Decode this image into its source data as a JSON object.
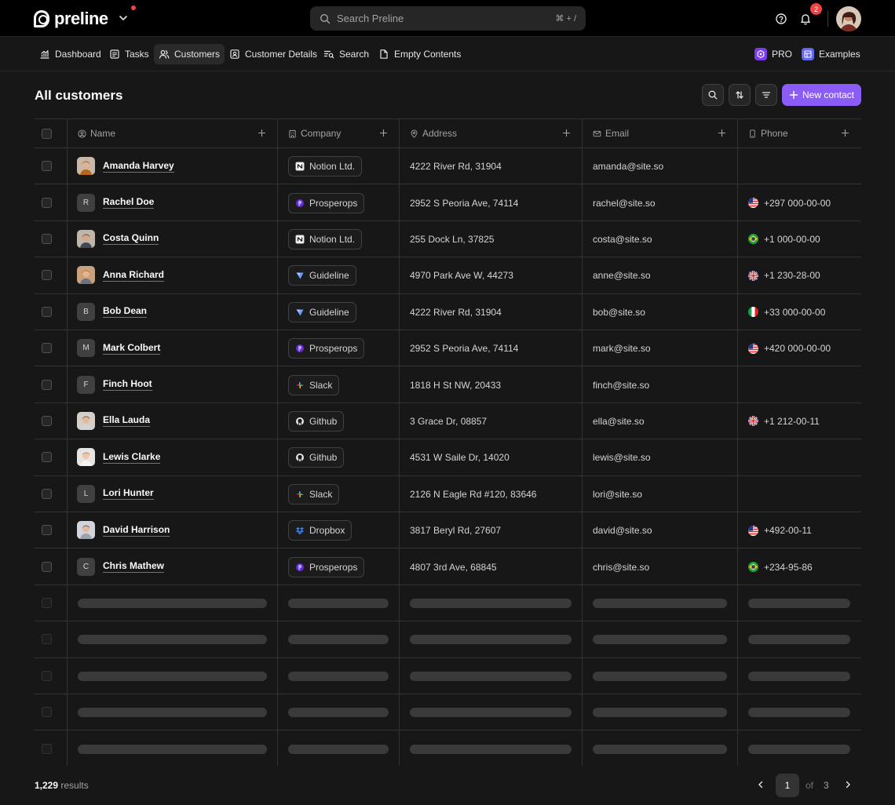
{
  "brand": {
    "name": "preline"
  },
  "search": {
    "placeholder": "Search Preline",
    "shortcut": "⌘ + /"
  },
  "notifications": {
    "count": "2"
  },
  "nav": {
    "items": [
      {
        "label": "Dashboard",
        "icon": "chart-icon"
      },
      {
        "label": "Tasks",
        "icon": "tasks-icon"
      },
      {
        "label": "Customers",
        "icon": "users-icon",
        "active": true
      },
      {
        "label": "Customer Details",
        "icon": "contact-card-icon"
      },
      {
        "label": "Search",
        "icon": "search-list-icon"
      },
      {
        "label": "Empty Contents",
        "icon": "file-icon"
      }
    ],
    "pro": "PRO",
    "examples": "Examples"
  },
  "page": {
    "title": "All customers",
    "new_contact": "New contact"
  },
  "table": {
    "columns": [
      {
        "label": "Name",
        "icon": "user-circle-icon"
      },
      {
        "label": "Company",
        "icon": "building-icon"
      },
      {
        "label": "Address",
        "icon": "pin-icon"
      },
      {
        "label": "Email",
        "icon": "mail-icon"
      },
      {
        "label": "Phone",
        "icon": "phone-icon"
      }
    ],
    "rows": [
      {
        "name": "Amanda Harvey",
        "avatar": "photo",
        "initial": "",
        "company": "Notion Ltd.",
        "company_icon": "notion",
        "address": "4222 River Rd, 31904",
        "email": "amanda@site.so",
        "phone": "",
        "flag": ""
      },
      {
        "name": "Rachel Doe",
        "avatar": "initial",
        "initial": "R",
        "company": "Prosperops",
        "company_icon": "prosperops",
        "address": "2952 S Peoria Ave, 74114",
        "email": "rachel@site.so",
        "phone": "+297 000-00-00",
        "flag": "us"
      },
      {
        "name": "Costa Quinn",
        "avatar": "photo",
        "initial": "",
        "company": "Notion Ltd.",
        "company_icon": "notion",
        "address": "255 Dock Ln, 37825",
        "email": "costa@site.so",
        "phone": "+1 000-00-00",
        "flag": "br"
      },
      {
        "name": "Anna Richard",
        "avatar": "photo",
        "initial": "",
        "company": "Guideline",
        "company_icon": "guideline",
        "address": "4970 Park Ave W, 44273",
        "email": "anne@site.so",
        "phone": "+1 230-28-00",
        "flag": "gb"
      },
      {
        "name": "Bob Dean",
        "avatar": "initial",
        "initial": "B",
        "company": "Guideline",
        "company_icon": "guideline",
        "address": "4222 River Rd, 31904",
        "email": "bob@site.so",
        "phone": "+33 000-00-00",
        "flag": "it"
      },
      {
        "name": "Mark Colbert",
        "avatar": "initial",
        "initial": "M",
        "company": "Prosperops",
        "company_icon": "prosperops",
        "address": "2952 S Peoria Ave, 74114",
        "email": "mark@site.so",
        "phone": "+420 000-00-00",
        "flag": "us"
      },
      {
        "name": "Finch Hoot",
        "avatar": "initial",
        "initial": "F",
        "company": "Slack",
        "company_icon": "slack",
        "address": "1818 H St NW, 20433",
        "email": "finch@site.so",
        "phone": "",
        "flag": ""
      },
      {
        "name": "Ella Lauda",
        "avatar": "photo",
        "initial": "",
        "company": "Github",
        "company_icon": "github",
        "address": "3 Grace Dr, 08857",
        "email": "ella@site.so",
        "phone": "+1 212-00-11",
        "flag": "gb"
      },
      {
        "name": "Lewis Clarke",
        "avatar": "photo",
        "initial": "",
        "company": "Github",
        "company_icon": "github",
        "address": "4531 W Saile Dr, 14020",
        "email": "lewis@site.so",
        "phone": "",
        "flag": ""
      },
      {
        "name": "Lori Hunter",
        "avatar": "initial",
        "initial": "L",
        "company": "Slack",
        "company_icon": "slack",
        "address": "2126 N Eagle Rd #120, 83646",
        "email": "lori@site.so",
        "phone": "",
        "flag": ""
      },
      {
        "name": "David Harrison",
        "avatar": "photo",
        "initial": "",
        "company": "Dropbox",
        "company_icon": "dropbox",
        "address": "3817 Beryl Rd, 27607",
        "email": "david@site.so",
        "phone": "+492-00-11",
        "flag": "us"
      },
      {
        "name": "Chris Mathew",
        "avatar": "initial",
        "initial": "C",
        "company": "Prosperops",
        "company_icon": "prosperops",
        "address": "4807 3rd Ave, 68845",
        "email": "chris@site.so",
        "phone": "+234-95-86",
        "flag": "br"
      }
    ],
    "skeleton_rows": 5
  },
  "footer": {
    "results_count": "1,229",
    "results_label": "results",
    "current_page": "1",
    "of_label": "of",
    "total_pages": "3"
  },
  "colors": {
    "accent": "#8b5cf6",
    "background": "#171717",
    "topbar": "#000000",
    "badge": "#ef4444"
  }
}
